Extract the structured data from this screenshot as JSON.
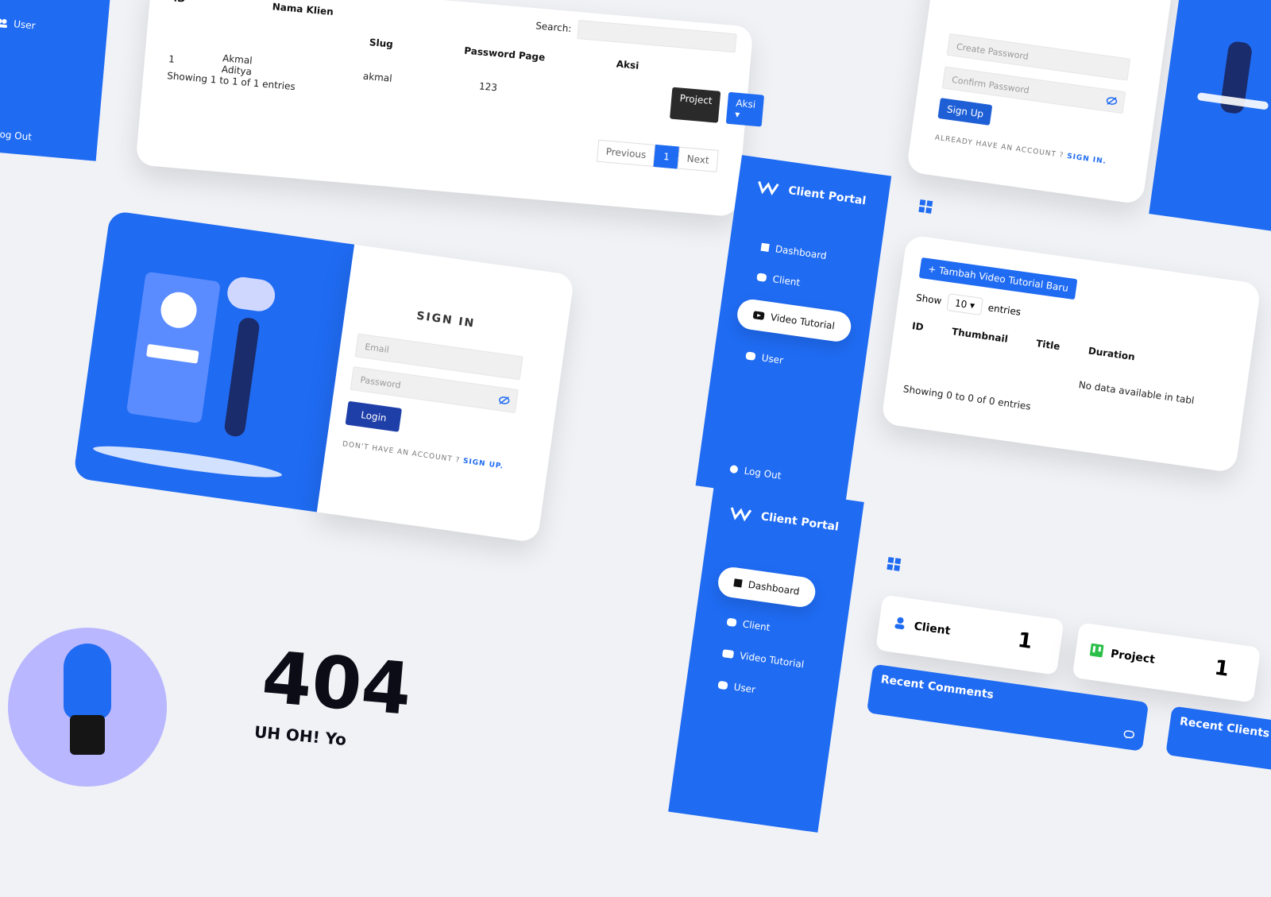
{
  "top_left_sidebar": {
    "user_label": "User",
    "logout_label": "Log Out"
  },
  "clients_table": {
    "headers": [
      "ID",
      "Nama Klien",
      "Slug",
      "Password Page",
      "Aksi"
    ],
    "search_label": "Search:",
    "row": {
      "id": "1",
      "nama": "Akmal Aditya",
      "slug": "akmal",
      "password": "123"
    },
    "buttons": {
      "project": "Project",
      "aksi": "Aksi ▾"
    },
    "showing": "Showing 1 to 1 of 1 entries",
    "pagination": {
      "prev": "Previous",
      "page": "1",
      "next": "Next"
    }
  },
  "signup_form": {
    "create_password_placeholder": "Create Password",
    "confirm_password_placeholder": "Confirm Password",
    "signup_button": "Sign Up",
    "already_text": "ALREADY HAVE AN ACCOUNT ? ",
    "signin_link": "SIGN IN."
  },
  "signin": {
    "title": "SIGN IN",
    "email_placeholder": "Email",
    "password_placeholder": "Password",
    "login_button": "Login",
    "dont_have_text": "DON'T HAVE AN ACCOUNT ? ",
    "signup_link": "SIGN UP."
  },
  "portal1": {
    "brand": "Client Portal",
    "nav": [
      "Dashboard",
      "Client",
      "Video Tutorial",
      "User"
    ],
    "active": "Video Tutorial",
    "logout": "Log Out",
    "add_button": "+ Tambah Video Tutorial Baru",
    "show_label": "Show",
    "entries_value": "10",
    "entries_label": "entries",
    "headers": [
      "ID",
      "Thumbnail",
      "Title",
      "Duration"
    ],
    "no_data": "No data available in tabl",
    "showing": "Showing 0 to 0 of 0 entries"
  },
  "portal2": {
    "brand": "Client Portal",
    "nav": [
      "Dashboard",
      "Client",
      "Video Tutorial",
      "User"
    ],
    "active": "Dashboard",
    "cards": [
      {
        "label": "Client",
        "value": "1"
      },
      {
        "label": "Project",
        "value": "1"
      }
    ],
    "recent_comments": "Recent Comments",
    "recent_clients": "Recent Clients"
  },
  "not_found": {
    "code": "404",
    "message": "UH OH! Yo"
  },
  "colors": {
    "accent": "#1f6bf2",
    "dark_button": "#2a2a2a",
    "light_bg": "#f1f2f6"
  }
}
